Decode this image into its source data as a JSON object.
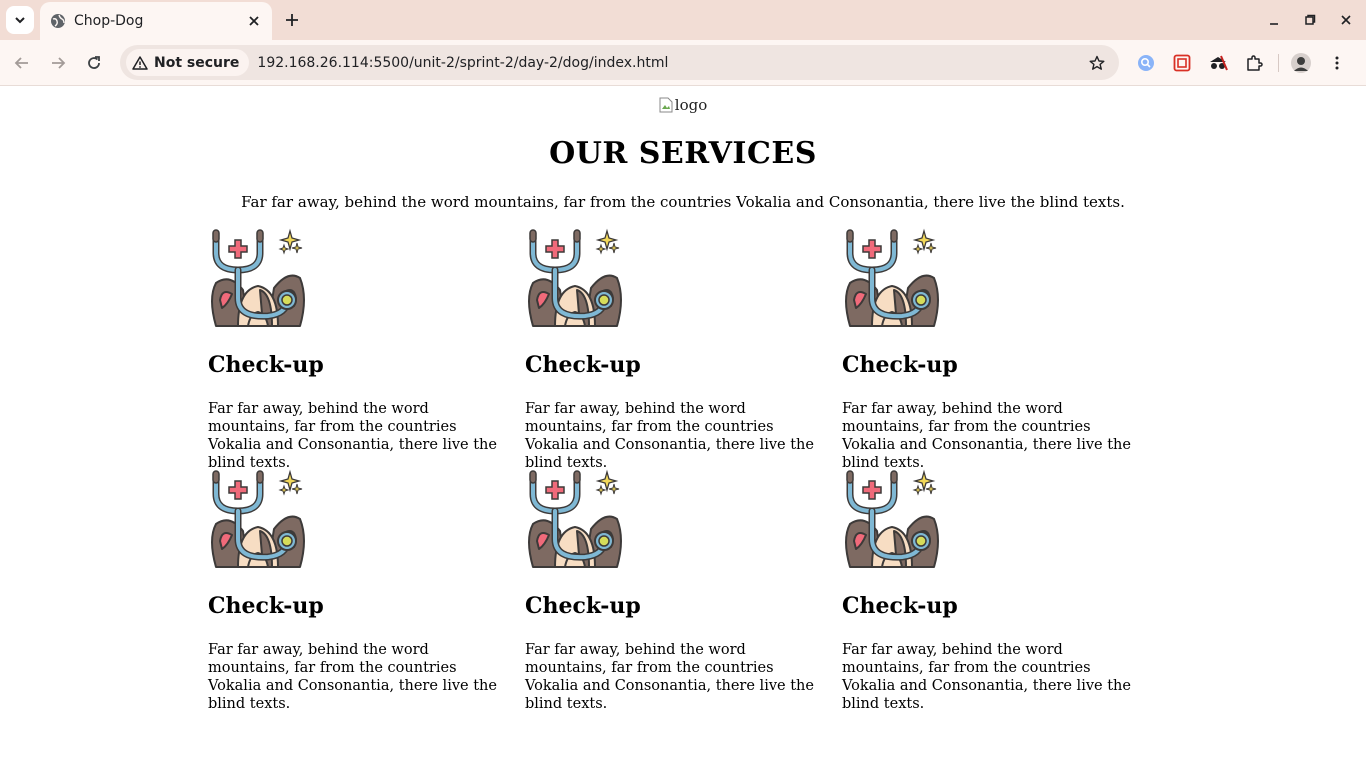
{
  "browser": {
    "tab_title": "Chop-Dog",
    "security_label": "Not secure",
    "url": "192.168.26.114:5500/unit-2/sprint-2/day-2/dog/index.html"
  },
  "page": {
    "logo_alt": "logo",
    "heading": "OUR SERVICES",
    "intro": "Far far away, behind the word mountains, far from the countries Vokalia and Consonantia, there live the blind texts.",
    "services": [
      {
        "title": "Check-up",
        "description": "Far far away, behind the word mountains, far from the countries Vokalia and Consonantia, there live the blind texts."
      },
      {
        "title": "Check-up",
        "description": "Far far away, behind the word mountains, far from the countries Vokalia and Consonantia, there live the blind texts."
      },
      {
        "title": "Check-up",
        "description": "Far far away, behind the word mountains, far from the countries Vokalia and Consonantia, there live the blind texts."
      },
      {
        "title": "Check-up",
        "description": "Far far away, behind the word mountains, far from the countries Vokalia and Consonantia, there live the blind texts."
      },
      {
        "title": "Check-up",
        "description": "Far far away, behind the word mountains, far from the countries Vokalia and Consonantia, there live the blind texts."
      },
      {
        "title": "Check-up",
        "description": "Far far away, behind the word mountains, far from the countries Vokalia and Consonantia, there live the blind texts."
      }
    ]
  },
  "icons": {
    "service": "dog-stethoscope-icon"
  },
  "colors": {
    "tabbar_bg": "#f2ddd5",
    "toolbar_bg": "#fdf6f3",
    "omnibox_bg": "#efe5e1"
  }
}
